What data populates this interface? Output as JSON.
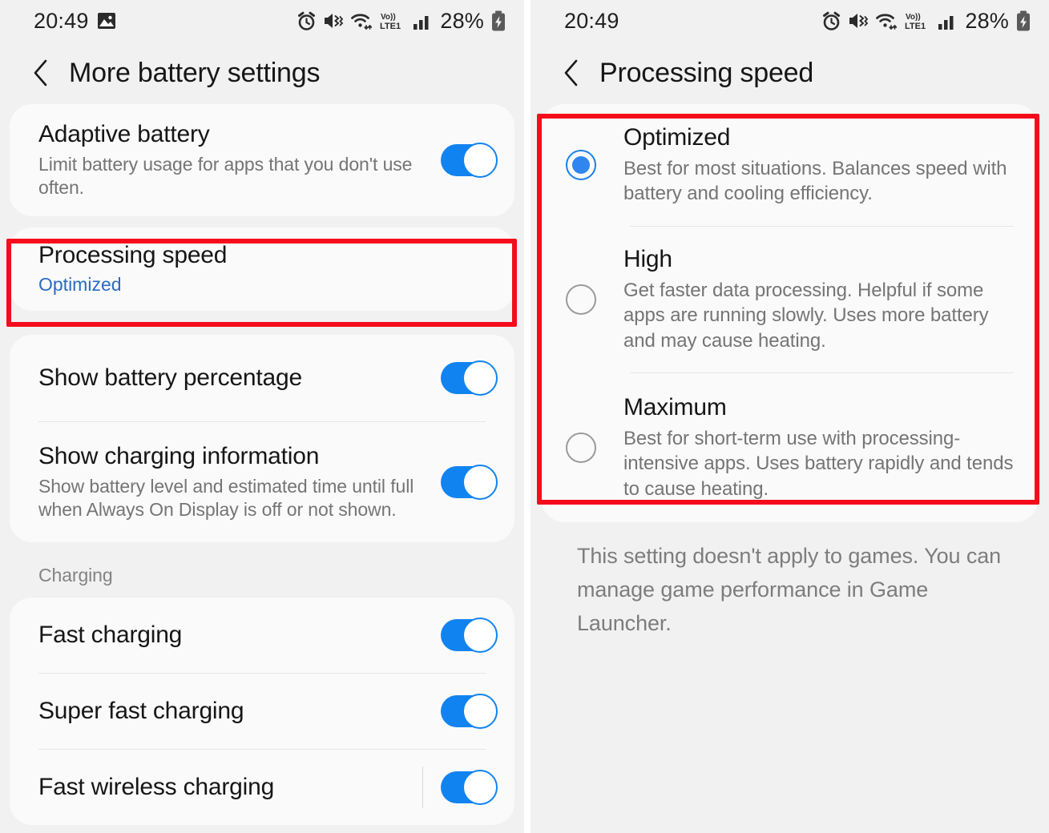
{
  "status_bar": {
    "time": "20:49",
    "battery_percent": "28%",
    "icons_left": [
      "gallery-image-icon"
    ],
    "icons_right": [
      "alarm-icon",
      "mute-vibrate-icon",
      "wifi-icon",
      "volte-lte1-icon",
      "signal-bars-icon",
      "battery-charging-icon"
    ],
    "volte_top": "Vo))",
    "volte_bottom": "LTE1"
  },
  "colors": {
    "accent_blue": "#1183f0",
    "link_blue": "#2b6bc4",
    "radio_blue": "#2f86ef",
    "highlight_red": "#f50c1c",
    "screen_bg": "#f1f1f1",
    "card_bg": "#fafafa"
  },
  "left_screen": {
    "header_title": "More battery settings",
    "back_label": "Back",
    "card1": [
      {
        "title": "Adaptive battery",
        "subtitle": "Limit battery usage for apps that you don't use often.",
        "control": "toggle",
        "toggle_on": true
      }
    ],
    "card2": [
      {
        "title": "Processing speed",
        "value": "Optimized",
        "control": "none",
        "highlighted": true
      }
    ],
    "card3": [
      {
        "title": "Show battery percentage",
        "subtitle": "",
        "control": "toggle",
        "toggle_on": true
      },
      {
        "title": "Show charging information",
        "subtitle": "Show battery level and estimated time until full when Always On Display is off or not shown.",
        "control": "toggle",
        "toggle_on": true
      }
    ],
    "section_label": "Charging",
    "card4": [
      {
        "title": "Fast charging",
        "control": "toggle",
        "toggle_on": true,
        "has_divider_rule": false
      },
      {
        "title": "Super fast charging",
        "control": "toggle",
        "toggle_on": true,
        "has_divider_rule": false
      },
      {
        "title": "Fast wireless charging",
        "control": "toggle",
        "toggle_on": true,
        "has_divider_rule": true
      }
    ]
  },
  "right_screen": {
    "header_title": "Processing speed",
    "back_label": "Back",
    "options": [
      {
        "title": "Optimized",
        "subtitle": "Best for most situations. Balances speed with battery and cooling efficiency.",
        "selected": true
      },
      {
        "title": "High",
        "subtitle": "Get faster data processing. Helpful if some apps are running slowly. Uses more battery and may cause heating.",
        "selected": false
      },
      {
        "title": "Maximum",
        "subtitle": "Best for short-term use with processing-intensive apps. Uses battery rapidly and tends to cause heating.",
        "selected": false
      }
    ],
    "footnote": "This setting doesn't apply to games. You can manage game performance in Game Launcher."
  }
}
